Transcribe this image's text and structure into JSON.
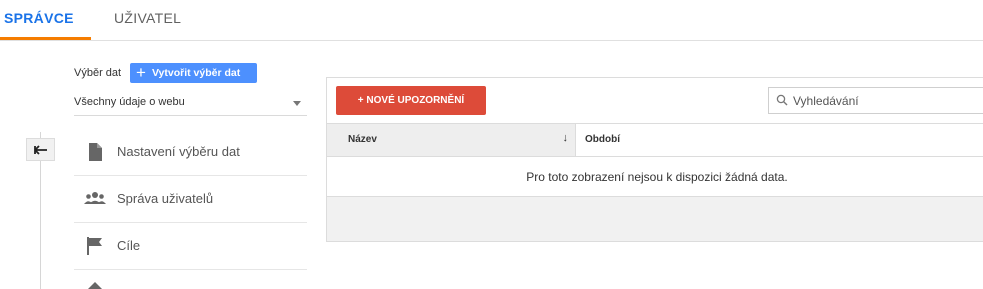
{
  "tabs": [
    {
      "label": "SPRÁVCE"
    },
    {
      "label": "UŽIVATEL"
    }
  ],
  "left": {
    "view_label": "Výběr dat",
    "create_view_button": "Vytvořit výběr dat",
    "view_select_value": "Všechny údaje o webu",
    "nav_items": [
      {
        "label": "Nastavení výběru dat",
        "icon": "document-icon"
      },
      {
        "label": "Správa uživatelů",
        "icon": "people-icon"
      },
      {
        "label": "Cíle",
        "icon": "flag-icon"
      }
    ]
  },
  "panel": {
    "new_alert_button": "+ NOVÉ UPOZORNĚNÍ",
    "search_placeholder": "Vyhledávání",
    "columns": [
      "Název",
      "Období"
    ],
    "empty_message": "Pro toto zobrazení nejsou k dispozici žádná data."
  },
  "colors": {
    "accent_blue": "#1a73e8",
    "tab_underline": "#f57c00",
    "create_button": "#4d90fe",
    "alert_button": "#dd4b39"
  }
}
